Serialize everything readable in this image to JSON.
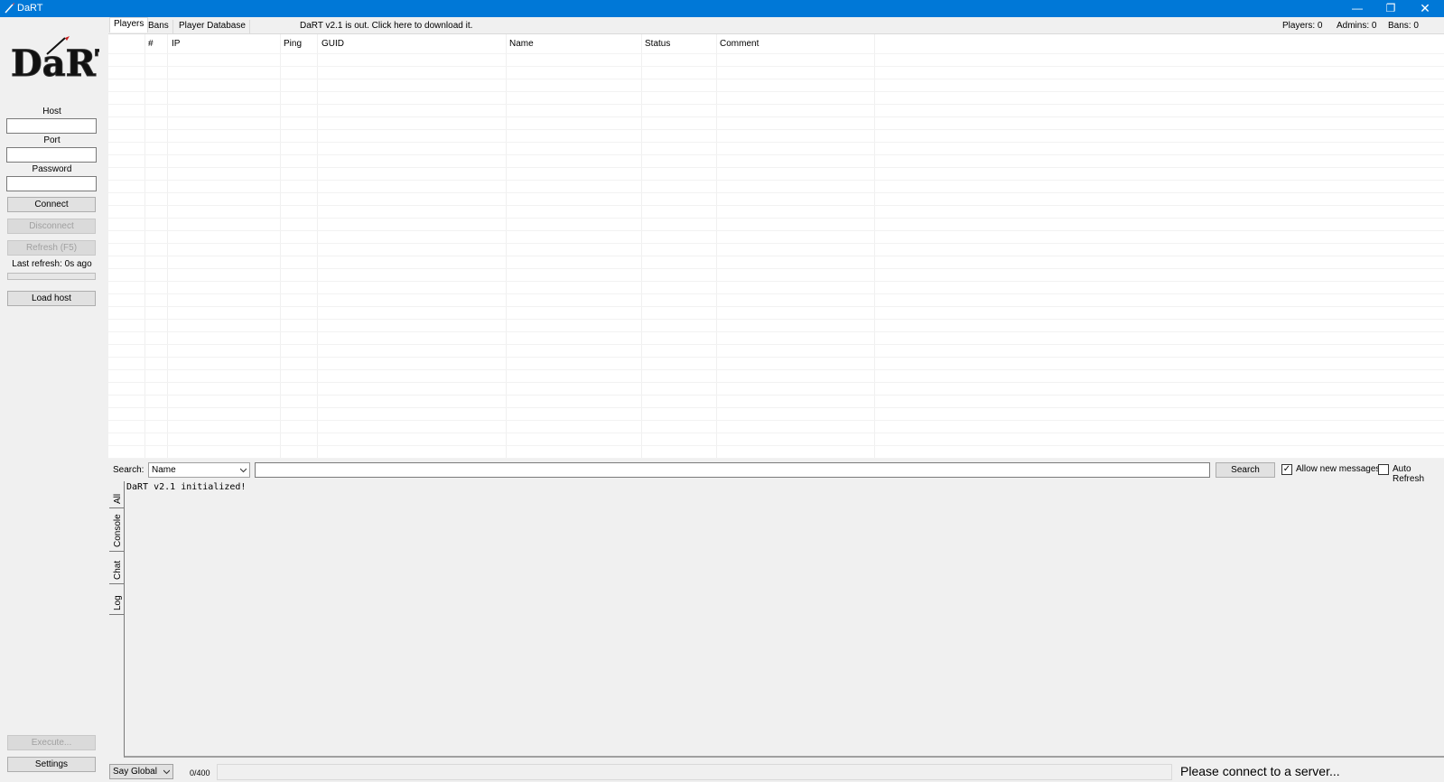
{
  "window": {
    "title": "DaRT",
    "minimize": "—",
    "restore": "❐",
    "close": "✕"
  },
  "logo_text": "DaRT",
  "sidebar": {
    "host_label": "Host",
    "host_value": "",
    "port_label": "Port",
    "port_value": "",
    "password_label": "Password",
    "password_value": "",
    "connect": "Connect",
    "disconnect": "Disconnect",
    "refresh": "Refresh (F5)",
    "last_refresh": "Last refresh: 0s ago",
    "refresh_progress": 0,
    "load_host": "Load host",
    "execute": "Execute...",
    "settings": "Settings"
  },
  "tabs": [
    "Players",
    "Bans",
    "Player Database"
  ],
  "update_notice": "DaRT v2.1 is out. Click here to download it.",
  "counts": {
    "players": "Players: 0",
    "admins": "Admins: 0",
    "bans": "Bans: 0"
  },
  "table": {
    "columns": [
      "#",
      "IP",
      "Ping",
      "GUID",
      "Name",
      "Status",
      "Comment"
    ],
    "rows": []
  },
  "search": {
    "label": "Search:",
    "field": "Name",
    "query": "",
    "button": "Search",
    "allow_new_messages": {
      "label": "Allow new messages",
      "checked": true
    },
    "auto_refresh": {
      "label": "Auto Refresh",
      "checked": false
    }
  },
  "console_tabs": [
    "All",
    "Console",
    "Chat",
    "Log"
  ],
  "console_lines": [
    "DaRT v2.1 initialized!"
  ],
  "bottom": {
    "say_mode": "Say Global",
    "char_count": "0/400",
    "message": "",
    "status": "Please connect to a server..."
  },
  "colors": {
    "titlebar": "#0078d7",
    "background": "#f0f0f0"
  }
}
